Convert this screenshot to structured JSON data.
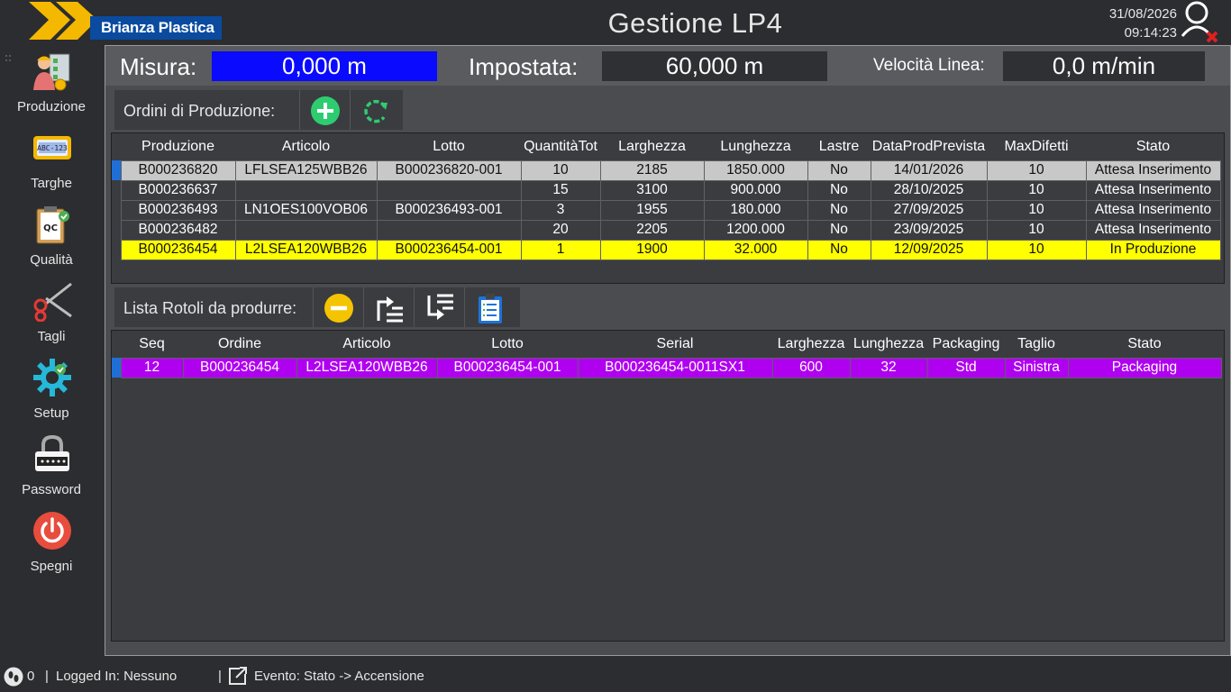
{
  "header": {
    "brand": "Brianza Plastica",
    "title": "Gestione LP4",
    "date": "31/08/2026",
    "time": "09:14:23"
  },
  "sidebar": {
    "items": [
      {
        "label": "Produzione",
        "icon": "worker-checklist-icon"
      },
      {
        "label": "Targhe",
        "icon": "license-plate-icon"
      },
      {
        "label": "Qualità",
        "icon": "qc-clipboard-icon"
      },
      {
        "label": "Tagli",
        "icon": "scissors-icon"
      },
      {
        "label": "Setup",
        "icon": "gear-check-icon"
      },
      {
        "label": "Password",
        "icon": "padlock-icon"
      },
      {
        "label": "Spegni",
        "icon": "power-icon"
      }
    ]
  },
  "measures": {
    "misura_label": "Misura:",
    "misura_value": "0,000 m",
    "impostata_label": "Impostata:",
    "impostata_value": "60,000 m",
    "velocita_label": "Velocità Linea:",
    "velocita_value": "0,0 m/min"
  },
  "orders": {
    "toolbar_label": "Ordini di Produzione:",
    "columns": [
      "Produzione",
      "Articolo",
      "Lotto",
      "QuantitàTot",
      "Larghezza",
      "Lunghezza",
      "Lastre",
      "DataProdPrevista",
      "MaxDifetti",
      "Stato"
    ],
    "rows": [
      [
        "B000236820",
        "LFLSEA125WBB26",
        "B000236820-001",
        "10",
        "2185",
        "1850.000",
        "No",
        "14/01/2026",
        "10",
        "Attesa Inserimento"
      ],
      [
        "B000236637",
        "",
        "",
        "15",
        "3100",
        "900.000",
        "No",
        "28/10/2025",
        "10",
        "Attesa Inserimento"
      ],
      [
        "B000236493",
        "LN1OES100VOB06",
        "B000236493-001",
        "3",
        "1955",
        "180.000",
        "No",
        "27/09/2025",
        "10",
        "Attesa Inserimento"
      ],
      [
        "B000236482",
        "",
        "",
        "20",
        "2205",
        "1200.000",
        "No",
        "23/09/2025",
        "10",
        "Attesa Inserimento"
      ],
      [
        "B000236454",
        "L2LSEA120WBB26",
        "B000236454-001",
        "1",
        "1900",
        "32.000",
        "No",
        "12/09/2025",
        "10",
        "In Produzione"
      ]
    ]
  },
  "rolls": {
    "toolbar_label": "Lista Rotoli da produrre:",
    "columns": [
      "Seq",
      "Ordine",
      "Articolo",
      "Lotto",
      "Serial",
      "Larghezza",
      "Lunghezza",
      "Packaging",
      "Taglio",
      "Stato"
    ],
    "rows": [
      [
        "12",
        "B000236454",
        "L2LSEA120WBB26",
        "B000236454-001",
        "B000236454-0011SX1",
        "600",
        "32",
        "Std",
        "Sinistra",
        "Packaging"
      ]
    ]
  },
  "status": {
    "count": "0",
    "logged": "Logged In: Nessuno",
    "event": "Evento: Stato -> Accensione"
  },
  "colors": {
    "accent_blue": "#0a0aff",
    "selected_marker": "#1f6fd6",
    "row_in_production": "#ffff00",
    "row_packaging": "#b000f0"
  }
}
